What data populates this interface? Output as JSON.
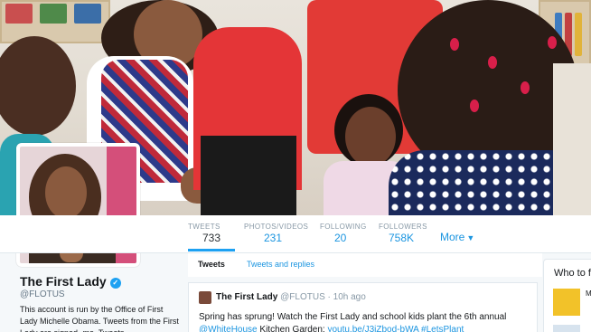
{
  "profile": {
    "name": "The First Lady",
    "handle": "@FLOTUS",
    "bio": "This account is run by the Office of First Lady Michelle Obama. Tweets from the First Lady are signed -mo. Tweets",
    "verified_icon": "verified-badge-icon"
  },
  "stats": [
    {
      "label": "TWEETS",
      "value": "733"
    },
    {
      "label": "PHOTOS/VIDEOS",
      "value": "231"
    },
    {
      "label": "FOLLOWING",
      "value": "20"
    },
    {
      "label": "FOLLOWERS",
      "value": "758K"
    }
  ],
  "more_label": "More",
  "tabs": {
    "tweets": "Tweets",
    "replies": "Tweets and replies"
  },
  "tweet": {
    "name": "The First Lady",
    "handle": "@FLOTUS",
    "time": "· 10h ago",
    "text": "Spring has sprung! Watch the First Lady and school kids plant the 6th annual",
    "mention": "@WhiteHouse",
    "text2": " Kitchen Garden: ",
    "link": "youtu.be/J3iZbod-bWA",
    "hashtag": " #LetsPlant"
  },
  "who_to_follow": {
    "title": "Who to follow",
    "item_initial": "M"
  },
  "colors": {
    "accent": "#1da1f2",
    "link": "#1b95e0"
  }
}
